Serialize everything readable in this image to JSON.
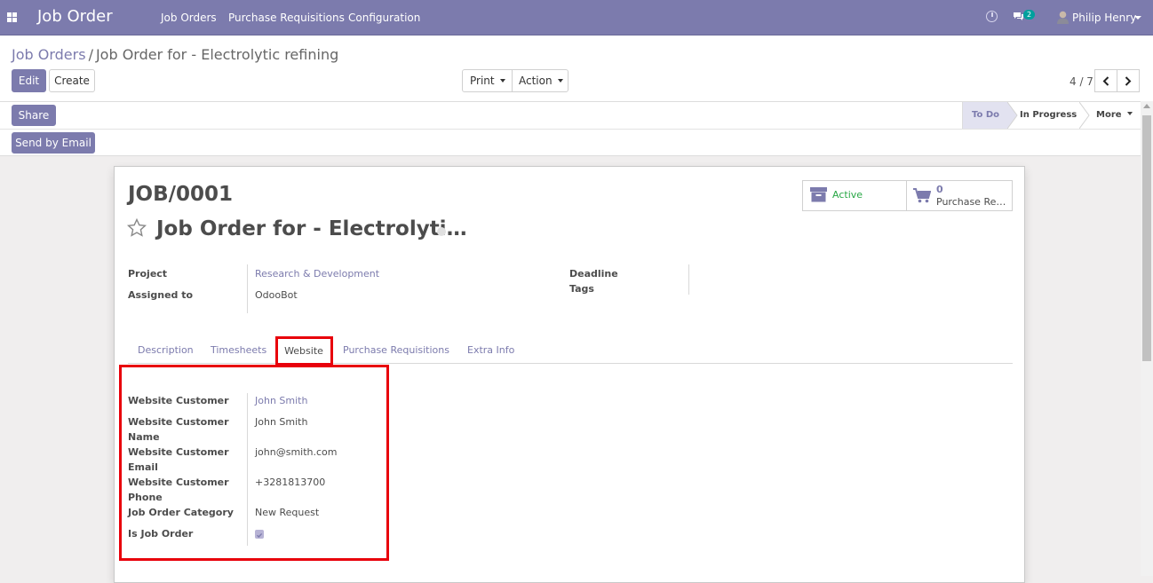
{
  "navbar": {
    "brand": "Job Order",
    "menu": [
      "Job Orders",
      "Purchase Requisitions",
      "Configuration"
    ],
    "chat_count": "2",
    "user_name": "Philip Henry",
    "bg_color": "#7c7bad"
  },
  "breadcrumb": {
    "parent": "Job Orders",
    "separator": "/",
    "current": "Job Order for - Electrolytic refining"
  },
  "toolbar": {
    "edit_label": "Edit",
    "create_label": "Create",
    "print_label": "Print",
    "action_label": "Action",
    "pager": "4 / 7"
  },
  "header_buttons": {
    "share_label": "Share",
    "send_email_label": "Send by Email"
  },
  "statusbar": {
    "stages": [
      "To Do",
      "In Progress"
    ],
    "active_stage": "To Do",
    "more_label": "More"
  },
  "record": {
    "reference": "JOB/0001",
    "title": "Job Order for - Electrolyti…",
    "smart_buttons": {
      "active_label": "Active",
      "purchase_count": "0",
      "purchase_label": "Purchase Re…"
    },
    "fields": {
      "project_label": "Project",
      "project_value": "Research & Development",
      "assigned_label": "Assigned to",
      "assigned_value": "OdooBot",
      "deadline_label": "Deadline",
      "tags_label": "Tags"
    },
    "tabs": [
      "Description",
      "Timesheets",
      "Website",
      "Purchase Requisitions",
      "Extra Info"
    ],
    "active_tab": "Website",
    "website_tab": {
      "customer_label": "Website Customer",
      "customer_value": "John Smith",
      "name_label_1": "Website Customer",
      "name_label_2": "Name",
      "name_value": "John Smith",
      "email_label_1": "Website Customer",
      "email_label_2": "Email",
      "email_value": "john@smith.com",
      "phone_label_1": "Website Customer",
      "phone_label_2": "Phone",
      "phone_value": "+3281813700",
      "category_label": "Job Order Category",
      "category_value": "New Request",
      "is_job_order_label": "Is Job Order",
      "is_job_order_checked": true
    }
  },
  "colors": {
    "accent": "#7c7bad",
    "highlight": "#e8000b",
    "active_green": "#28a745"
  },
  "icons": [
    "apps-icon",
    "clock-icon",
    "chat-icon",
    "avatar",
    "star-icon",
    "archive-icon",
    "cart-icon",
    "chevron-left-icon",
    "chevron-right-icon"
  ]
}
